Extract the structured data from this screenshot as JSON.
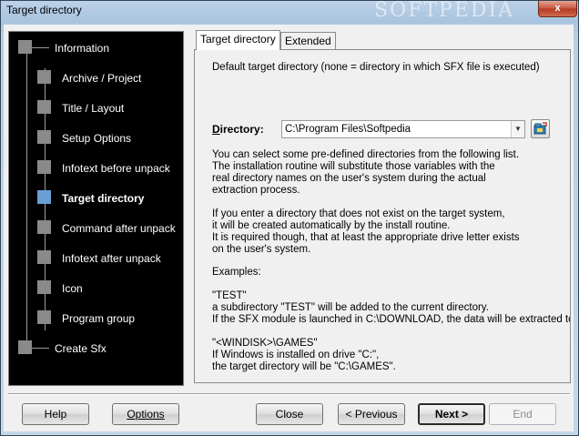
{
  "window": {
    "title": "Target directory",
    "watermark": "SOFTPEDIA",
    "close_glyph": "x"
  },
  "sidebar": {
    "items": [
      {
        "label": "Information",
        "active": false
      },
      {
        "label": "Archive / Project",
        "active": false
      },
      {
        "label": "Title / Layout",
        "active": false
      },
      {
        "label": "Setup Options",
        "active": false
      },
      {
        "label": "Infotext before unpack",
        "active": false
      },
      {
        "label": "Target directory",
        "active": true
      },
      {
        "label": "Command after unpack",
        "active": false
      },
      {
        "label": "Infotext after unpack",
        "active": false
      },
      {
        "label": "Icon",
        "active": false
      },
      {
        "label": "Program group",
        "active": false
      },
      {
        "label": "Create Sfx",
        "active": false
      }
    ]
  },
  "tabs": [
    {
      "label": "Target directory",
      "active": true
    },
    {
      "label": "Extended",
      "active": false
    }
  ],
  "panel": {
    "default_label": "Default target directory (none = directory in which SFX file is executed)",
    "directory_label_first": "D",
    "directory_label_rest": "irectory:",
    "directory_value": "C:\\Program Files\\Softpedia",
    "help_lines": [
      "You can select some pre-defined directories from the following  list.",
      "The installation routine will substitute those variables with the",
      "real directory names on the user's system during the actual",
      "extraction process."
    ],
    "info_lines": [
      "If you enter a directory that does not exist on the target system,",
      "it will be created automatically by the install routine.",
      "It is required though, that at least the appropriate drive letter exists",
      "on the user's system."
    ],
    "examples_heading": "Examples:",
    "example1_lines": [
      "\"TEST\"",
      "a subdirectory \"TEST\" will be added to the current directory.",
      "If the SFX module is launched in C:\\DOWNLOAD, the data will be extracted to \"C"
    ],
    "example2_lines": [
      "\"<WINDISK>\\GAMES\"",
      "If Windows is installed on drive \"C:\",",
      "the target directory will be \"C:\\GAMES\"."
    ]
  },
  "buttons": {
    "help": "Help",
    "options": "Options",
    "close": "Close",
    "previous": "< Previous",
    "next": "Next >",
    "end": "End"
  },
  "colors": {
    "sidebar_bg": "#000000",
    "active_square": "#6a9fd6",
    "inactive_square": "#8a8a8a"
  }
}
